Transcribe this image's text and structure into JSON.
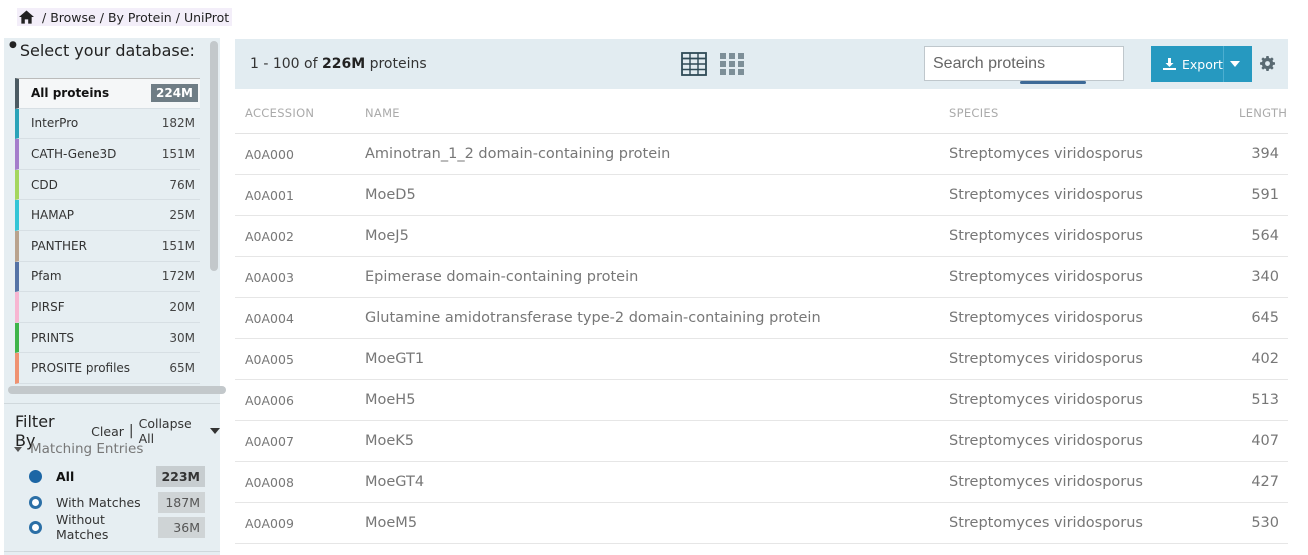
{
  "breadcrumb": {
    "home_icon": "home-icon",
    "items": [
      "Browse",
      "By Protein",
      "UniProt"
    ]
  },
  "database_panel": {
    "title": "Select your database:",
    "items": [
      {
        "label": "All proteins",
        "count": "224M",
        "color": "#4b5a62",
        "active": true
      },
      {
        "label": "InterPro",
        "count": "182M",
        "color": "#2aa3b8"
      },
      {
        "label": "CATH-Gene3D",
        "count": "151M",
        "color": "#a47dcb"
      },
      {
        "label": "CDD",
        "count": "76M",
        "color": "#a4d65e"
      },
      {
        "label": "HAMAP",
        "count": "25M",
        "color": "#33c5d6"
      },
      {
        "label": "PANTHER",
        "count": "151M",
        "color": "#b9a38e"
      },
      {
        "label": "Pfam",
        "count": "172M",
        "color": "#5573a6"
      },
      {
        "label": "PIRSF",
        "count": "20M",
        "color": "#f7b6d2"
      },
      {
        "label": "PRINTS",
        "count": "30M",
        "color": "#3fb44a"
      },
      {
        "label": "PROSITE profiles",
        "count": "65M",
        "color": "#ef9271"
      }
    ]
  },
  "filter": {
    "title": "Filter By",
    "clear_label": "Clear",
    "collapse_label": "Collapse All",
    "section_title": "Matching Entries",
    "options": [
      {
        "label": "All",
        "count": "223M",
        "selected": true
      },
      {
        "label": "With Matches",
        "count": "187M",
        "selected": false
      },
      {
        "label": "Without Matches",
        "count": "36M",
        "selected": false
      }
    ]
  },
  "toolbar": {
    "range_text": "1 - 100 of ",
    "total": "226M",
    "unit": " proteins",
    "search_placeholder": "Search proteins",
    "export_label": "Export"
  },
  "table": {
    "columns": [
      "Accession",
      "Name",
      "Species",
      "Length"
    ],
    "rows": [
      {
        "accession": "A0A000",
        "name": "Aminotran_1_2 domain-containing protein",
        "species": "Streptomyces viridosporus",
        "length": "394"
      },
      {
        "accession": "A0A001",
        "name": "MoeD5",
        "species": "Streptomyces viridosporus",
        "length": "591"
      },
      {
        "accession": "A0A002",
        "name": "MoeJ5",
        "species": "Streptomyces viridosporus",
        "length": "564"
      },
      {
        "accession": "A0A003",
        "name": "Epimerase domain-containing protein",
        "species": "Streptomyces viridosporus",
        "length": "340"
      },
      {
        "accession": "A0A004",
        "name": "Glutamine amidotransferase type-2 domain-containing protein",
        "species": "Streptomyces viridosporus",
        "length": "645"
      },
      {
        "accession": "A0A005",
        "name": "MoeGT1",
        "species": "Streptomyces viridosporus",
        "length": "402"
      },
      {
        "accession": "A0A006",
        "name": "MoeH5",
        "species": "Streptomyces viridosporus",
        "length": "513"
      },
      {
        "accession": "A0A007",
        "name": "MoeK5",
        "species": "Streptomyces viridosporus",
        "length": "407"
      },
      {
        "accession": "A0A008",
        "name": "MoeGT4",
        "species": "Streptomyces viridosporus",
        "length": "427"
      },
      {
        "accession": "A0A009",
        "name": "MoeM5",
        "species": "Streptomyces viridosporus",
        "length": "530"
      }
    ]
  }
}
